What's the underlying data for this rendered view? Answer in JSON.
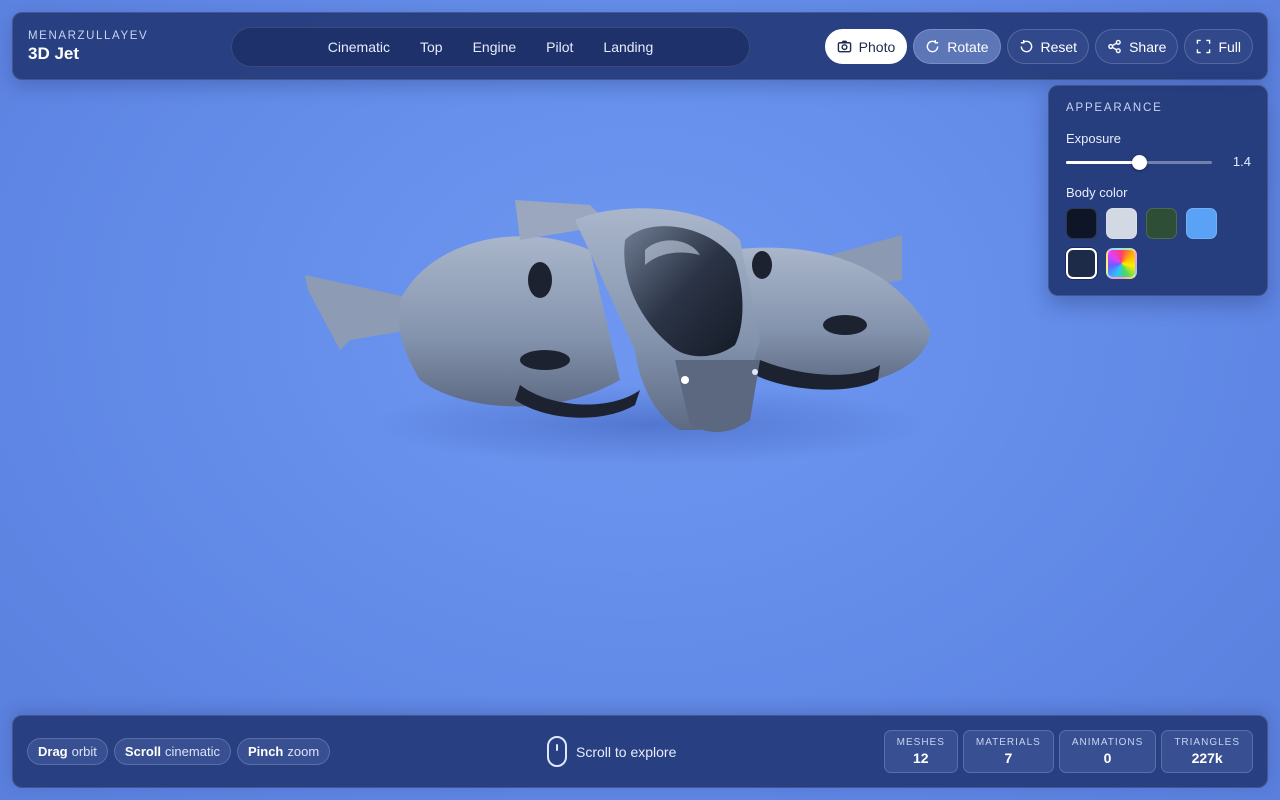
{
  "brand": {
    "subtitle": "MENARZULLAYEV",
    "title": "3D Jet"
  },
  "nav": {
    "items": [
      "Cinematic",
      "Top",
      "Engine",
      "Pilot",
      "Landing"
    ]
  },
  "actions": {
    "photo": "Photo",
    "rotate": "Rotate",
    "reset": "Reset",
    "share": "Share",
    "full": "Full"
  },
  "appearance": {
    "title": "APPEARANCE",
    "exposure_label": "Exposure",
    "exposure_value": "1.4",
    "exposure_fraction": 0.5,
    "body_color_label": "Body color",
    "swatches": [
      {
        "name": "black",
        "color": "#0d1526"
      },
      {
        "name": "silver",
        "color": "#d3d9e2"
      },
      {
        "name": "green",
        "color": "#2e4f36"
      },
      {
        "name": "blue",
        "color": "#5aa2f5"
      },
      {
        "name": "navy",
        "color": "#1d2a48",
        "selected": true
      },
      {
        "name": "custom",
        "color": "rainbow"
      }
    ]
  },
  "hints": [
    {
      "key": "Drag",
      "action": "orbit"
    },
    {
      "key": "Scroll",
      "action": "cinematic"
    },
    {
      "key": "Pinch",
      "action": "zoom"
    }
  ],
  "scroll_hint": "Scroll to explore",
  "stats": [
    {
      "label": "MESHES",
      "value": "12"
    },
    {
      "label": "MATERIALS",
      "value": "7"
    },
    {
      "label": "ANIMATIONS",
      "value": "0"
    },
    {
      "label": "TRIANGLES",
      "value": "227k"
    }
  ],
  "colors": {
    "background": "#6690ec",
    "panel": "#243a78",
    "accent": "#ffffff"
  }
}
